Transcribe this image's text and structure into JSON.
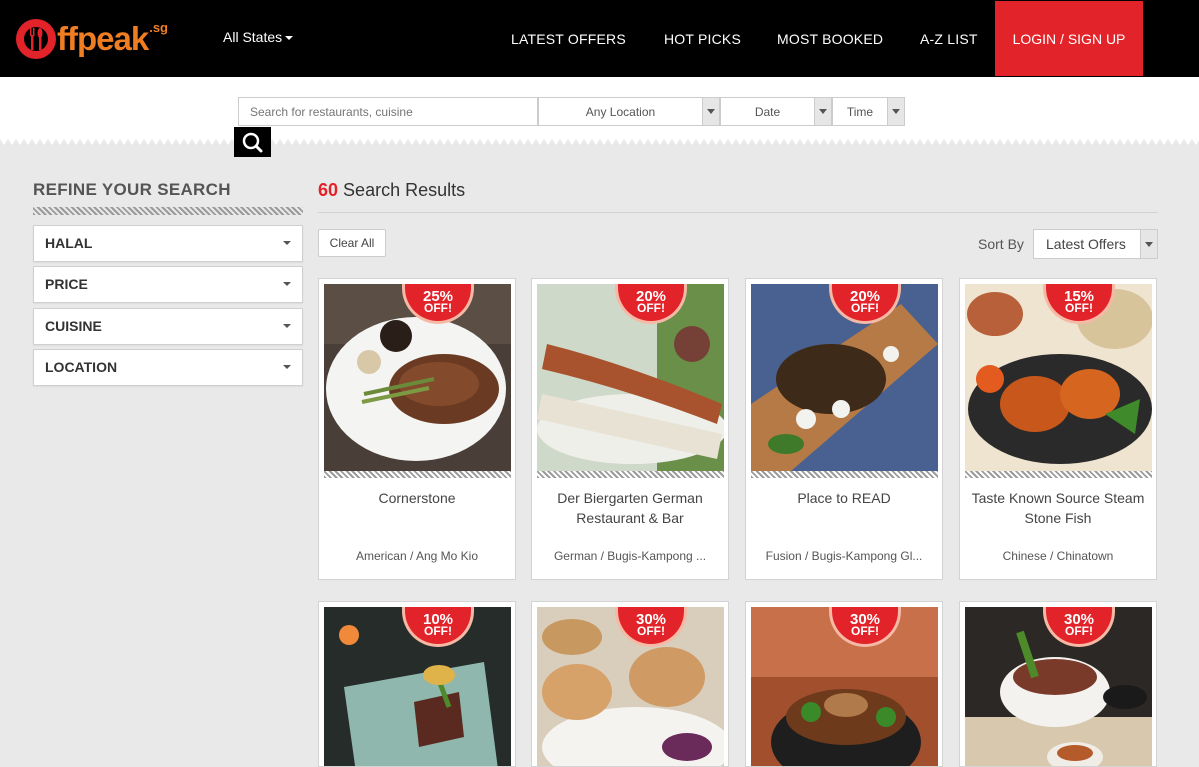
{
  "header": {
    "logo_text": "ffpeak",
    "logo_suffix": ".sg",
    "state_selector": "All States",
    "nav": [
      "LATEST OFFERS",
      "HOT PICKS",
      "MOST BOOKED",
      "A-Z LIST"
    ],
    "login": "LOGIN / SIGN UP",
    "colors": {
      "accent": "#e3232a",
      "logo": "#ef7d22",
      "bar": "#000000"
    }
  },
  "search": {
    "placeholder": "Search for restaurants, cuisine",
    "location": "Any Location",
    "date": "Date",
    "time": "Time",
    "button_icon": "search-icon"
  },
  "sidebar": {
    "title": "REFINE YOUR SEARCH",
    "filters": [
      "HALAL",
      "PRICE",
      "CUISINE",
      "LOCATION"
    ]
  },
  "results": {
    "count": "60",
    "label": "Search Results",
    "clear": "Clear All",
    "sort_label": "Sort By",
    "sort_value": "Latest Offers",
    "off_label": "OFF!",
    "cards": [
      {
        "discount": "25%",
        "name": "Cornerstone",
        "tag": "American / Ang Mo Kio"
      },
      {
        "discount": "20%",
        "name": "Der Biergarten German Restaurant & Bar",
        "tag": "German / Bugis-Kampong ..."
      },
      {
        "discount": "20%",
        "name": "Place to READ",
        "tag": "Fusion / Bugis-Kampong Gl..."
      },
      {
        "discount": "15%",
        "name": "Taste Known Source Steam Stone Fish",
        "tag": "Chinese / Chinatown"
      },
      {
        "discount": "10%",
        "name": "",
        "tag": ""
      },
      {
        "discount": "30%",
        "name": "",
        "tag": ""
      },
      {
        "discount": "30%",
        "name": "",
        "tag": ""
      },
      {
        "discount": "30%",
        "name": "",
        "tag": ""
      }
    ]
  }
}
